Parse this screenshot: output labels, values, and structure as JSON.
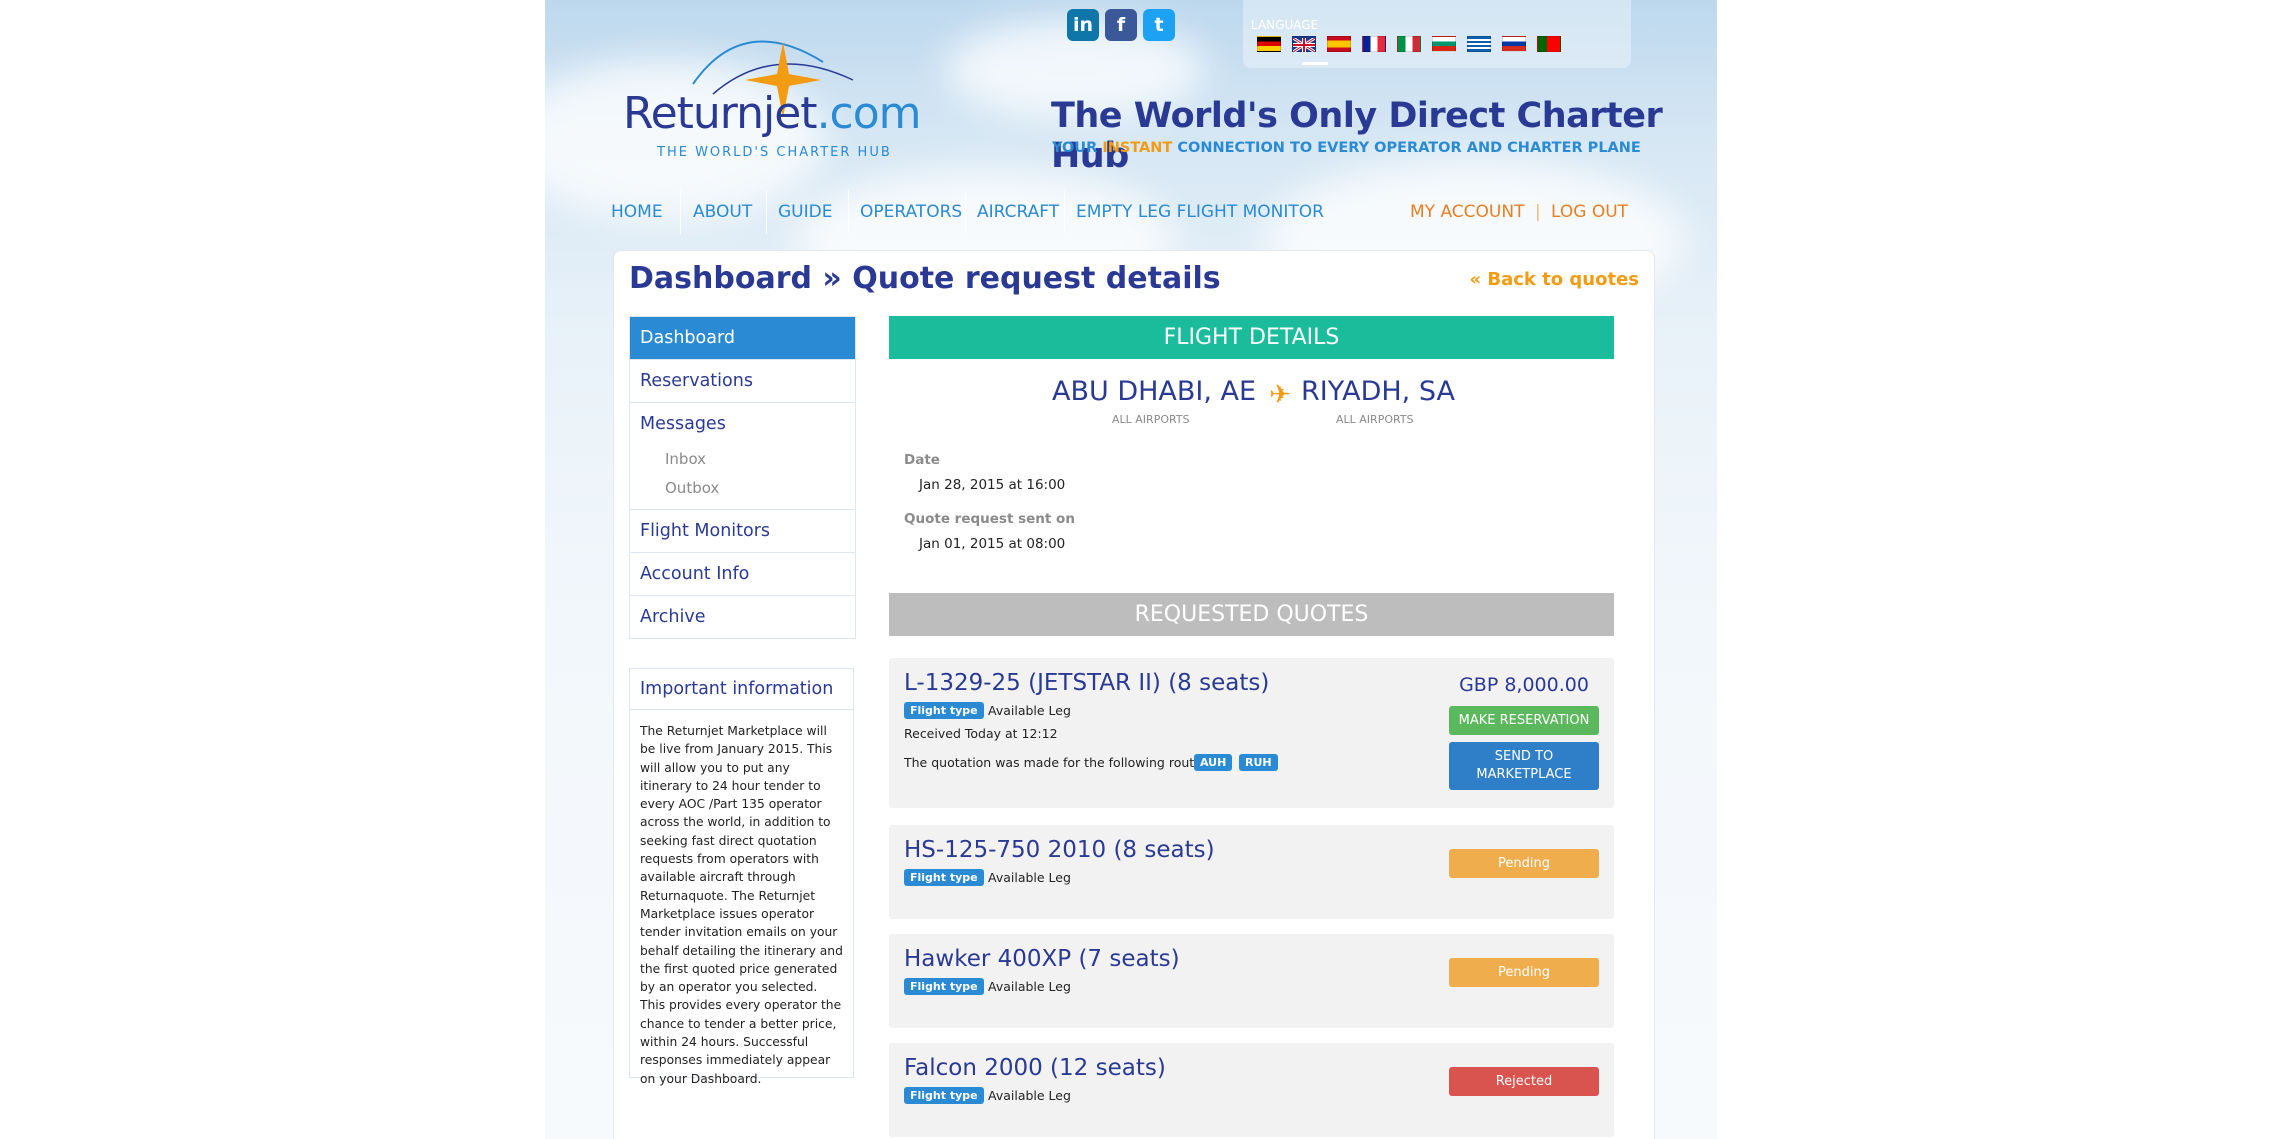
{
  "header": {
    "logo_name": "Returnjet",
    "logo_tld": ".com",
    "logo_subtitle": "THE WORLD'S CHARTER HUB",
    "tagline": "The World's Only Direct Charter Hub",
    "tagline_sub_1": "YOUR",
    "tagline_sub_hl": "INSTANT",
    "tagline_sub_2": "CONNECTION TO EVERY OPERATOR AND CHARTER PLANE",
    "social": [
      {
        "icon": "linkedin-icon",
        "glyph": "in",
        "color": "#0e76a8"
      },
      {
        "icon": "facebook-icon",
        "glyph": "f",
        "color": "#3b5998"
      },
      {
        "icon": "twitter-icon",
        "glyph": "t",
        "color": "#1da1f2"
      }
    ],
    "language_label": "LANGUAGE",
    "languages": [
      {
        "code": "de",
        "icon": "flag-germany-icon"
      },
      {
        "code": "en",
        "icon": "flag-uk-icon",
        "active": true
      },
      {
        "code": "es",
        "icon": "flag-spain-icon"
      },
      {
        "code": "fr",
        "icon": "flag-france-icon"
      },
      {
        "code": "it",
        "icon": "flag-italy-icon"
      },
      {
        "code": "bg",
        "icon": "flag-bulgaria-icon"
      },
      {
        "code": "gr",
        "icon": "flag-greece-icon"
      },
      {
        "code": "ru",
        "icon": "flag-russia-icon"
      },
      {
        "code": "pt",
        "icon": "flag-portugal-icon"
      }
    ]
  },
  "nav": {
    "items": [
      "HOME",
      "ABOUT",
      "GUIDE",
      "OPERATORS",
      "AIRCRAFT",
      "EMPTY LEG FLIGHT MONITOR"
    ],
    "my_account": "MY ACCOUNT",
    "separator": "|",
    "logout": "LOG OUT"
  },
  "page": {
    "title": "Dashboard » Quote request details",
    "back_link": "« Back to quotes"
  },
  "sidebar": {
    "items": {
      "dashboard": "Dashboard",
      "reservations": "Reservations",
      "messages": "Messages",
      "inbox": "Inbox",
      "outbox": "Outbox",
      "flight_monitors": "Flight Monitors",
      "account_info": "Account Info",
      "archive": "Archive"
    },
    "active": "dashboard"
  },
  "info": {
    "title": "Important information",
    "body": "The Returnjet Marketplace will be live from January 2015. This will allow you to put any itinerary to 24 hour tender to every AOC /Part 135 operator across the world, in addition to seeking fast direct quotation requests from operators with available aircraft through Returnaquote. The Returnjet Marketplace issues operator tender invitation emails on your behalf detailing the itinerary and the first quoted price generated by an operator you selected. This provides every operator the chance to tender a better price, within 24 hours. Successful responses immediately appear on your Dashboard."
  },
  "flight": {
    "heading": "FLIGHT DETAILS",
    "from_city": "ABU DHABI, AE",
    "from_sub": "ALL AIRPORTS",
    "to_city": "RIYADH, SA",
    "to_sub": "ALL AIRPORTS",
    "date_label": "Date",
    "date_value": "Jan 28, 2015 at 16:00",
    "sent_label": "Quote request sent on",
    "sent_value": "Jan 01, 2015 at 08:00"
  },
  "quotes": {
    "heading": "REQUESTED QUOTES",
    "tag_label": "Flight type",
    "items": [
      {
        "title": "L-1329-25 (JETSTAR II) (8 seats)",
        "type": "Available Leg",
        "received": "Received Today at 12:12",
        "route_text": "The quotation was made for the following route:",
        "route_from": "AUH",
        "route_to": "RUH",
        "price": "GBP 8,000.00",
        "reserve_label": "MAKE RESERVATION",
        "marketplace_label": "SEND TO MARKETPLACE"
      },
      {
        "title": "HS-125-750 2010 (8 seats)",
        "type": "Available Leg",
        "status": "Pending",
        "status_color": "#f0ad4e"
      },
      {
        "title": "Hawker 400XP (7 seats)",
        "type": "Available Leg",
        "status": "Pending",
        "status_color": "#f0ad4e"
      },
      {
        "title": "Falcon 2000 (12 seats)",
        "type": "Available Leg",
        "status": "Rejected",
        "status_color": "#d9534f"
      }
    ]
  },
  "colors": {
    "brand_navy": "#2a3a94",
    "brand_blue": "#2a8ad4",
    "accent_orange": "#f39c12",
    "teal": "#1abc9c"
  }
}
